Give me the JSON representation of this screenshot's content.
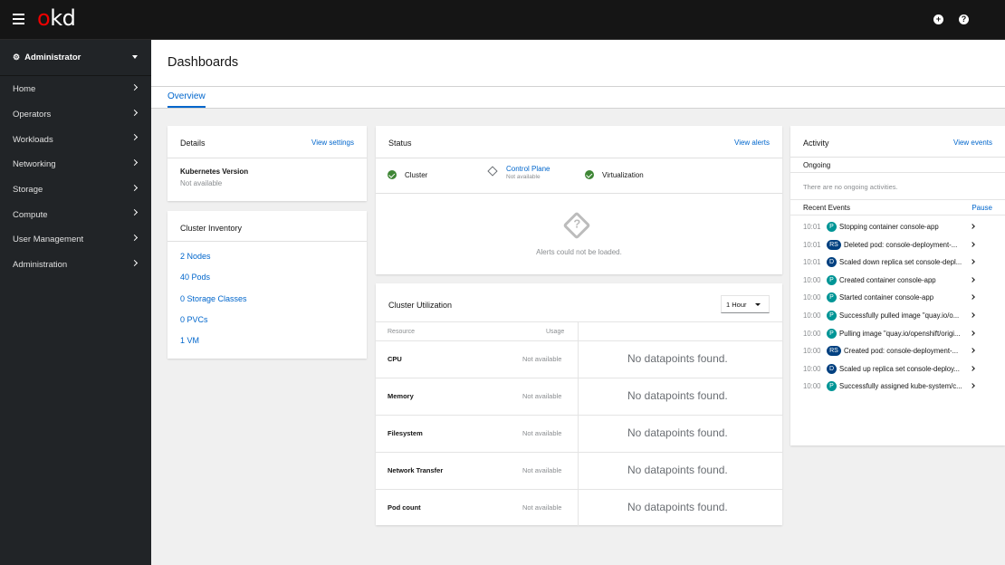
{
  "masthead": {
    "logo_prefix": "o",
    "logo_suffix": "kd",
    "add_icon": "+",
    "help_icon": "?"
  },
  "sidebar": {
    "perspective": "Administrator",
    "items": [
      {
        "label": "Home"
      },
      {
        "label": "Operators"
      },
      {
        "label": "Workloads"
      },
      {
        "label": "Networking"
      },
      {
        "label": "Storage"
      },
      {
        "label": "Compute"
      },
      {
        "label": "User Management"
      },
      {
        "label": "Administration"
      }
    ]
  },
  "page": {
    "title": "Dashboards",
    "tabs": [
      {
        "label": "Overview",
        "active": true
      }
    ]
  },
  "details": {
    "title": "Details",
    "link": "View settings",
    "k8s_label": "Kubernetes Version",
    "k8s_value": "Not available"
  },
  "inventory": {
    "title": "Cluster Inventory",
    "items": [
      "2 Nodes",
      "40 Pods",
      "0 Storage Classes",
      "0 PVCs",
      "1 VM"
    ]
  },
  "status": {
    "title": "Status",
    "link": "View alerts",
    "items": [
      {
        "label": "Cluster",
        "state": "ok"
      },
      {
        "label": "Control Plane",
        "sub": "Not available",
        "state": "unknown"
      },
      {
        "label": "Virtualization",
        "state": "ok"
      }
    ],
    "alerts_message": "Alerts could not be loaded."
  },
  "utilization": {
    "title": "Cluster Utilization",
    "range": "1 Hour",
    "col_resource": "Resource",
    "col_usage": "Usage",
    "rows": [
      {
        "resource": "CPU",
        "usage": "Not available",
        "chart": "No datapoints found."
      },
      {
        "resource": "Memory",
        "usage": "Not available",
        "chart": "No datapoints found."
      },
      {
        "resource": "Filesystem",
        "usage": "Not available",
        "chart": "No datapoints found."
      },
      {
        "resource": "Network Transfer",
        "usage": "Not available",
        "chart": "No datapoints found."
      },
      {
        "resource": "Pod count",
        "usage": "Not available",
        "chart": "No datapoints found."
      }
    ]
  },
  "activity": {
    "title": "Activity",
    "link": "View events",
    "ongoing_label": "Ongoing",
    "ongoing_empty": "There are no ongoing activities.",
    "recent_label": "Recent Events",
    "pause": "Pause",
    "badge_colors": {
      "P": "#009596",
      "RS": "#004080",
      "D": "#004080"
    },
    "events": [
      {
        "time": "10:01",
        "kind": "P",
        "msg": "Stopping container console-app"
      },
      {
        "time": "10:01",
        "kind": "RS",
        "msg": "Deleted pod: console-deployment-..."
      },
      {
        "time": "10:01",
        "kind": "D",
        "msg": "Scaled down replica set console-depl..."
      },
      {
        "time": "10:00",
        "kind": "P",
        "msg": "Created container console-app"
      },
      {
        "time": "10:00",
        "kind": "P",
        "msg": "Started container console-app"
      },
      {
        "time": "10:00",
        "kind": "P",
        "msg": "Successfully pulled image \"quay.io/o..."
      },
      {
        "time": "10:00",
        "kind": "P",
        "msg": "Pulling image \"quay.io/openshift/origi..."
      },
      {
        "time": "10:00",
        "kind": "RS",
        "msg": "Created pod: console-deployment-..."
      },
      {
        "time": "10:00",
        "kind": "D",
        "msg": "Scaled up replica set console-deploy..."
      },
      {
        "time": "10:00",
        "kind": "P",
        "msg": "Successfully assigned kube-system/c..."
      }
    ]
  }
}
